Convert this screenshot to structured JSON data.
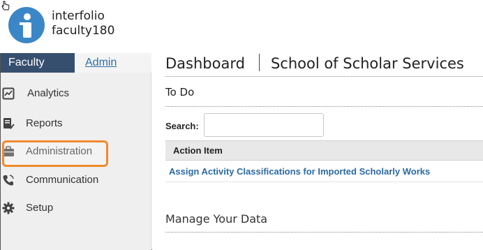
{
  "brand": {
    "line1": "interfolio",
    "line2": "faculty180",
    "logo_color": "#3b86c6"
  },
  "sidebar": {
    "tabs": [
      {
        "label": "Faculty",
        "active": true
      },
      {
        "label": "Admin",
        "active": false
      }
    ],
    "items": [
      {
        "label": "Analytics",
        "icon": "analytics-icon"
      },
      {
        "label": "Reports",
        "icon": "reports-icon"
      },
      {
        "label": "Administration",
        "icon": "briefcase-icon",
        "highlighted": true
      },
      {
        "label": "Communication",
        "icon": "phone-icon"
      },
      {
        "label": "Setup",
        "icon": "gear-icon"
      }
    ],
    "highlight_color": "#f08a2c"
  },
  "main": {
    "title": "Dashboard",
    "subtitle": "School of Scholar Services",
    "todo": {
      "heading": "To Do",
      "search_label": "Search:",
      "search_value": "",
      "column_header": "Action Item",
      "rows": [
        "Assign Activity Classifications for Imported Scholarly Works"
      ]
    },
    "manage_heading": "Manage Your Data"
  },
  "colors": {
    "active_tab": "#364f6f",
    "link": "#2b6aa5"
  }
}
